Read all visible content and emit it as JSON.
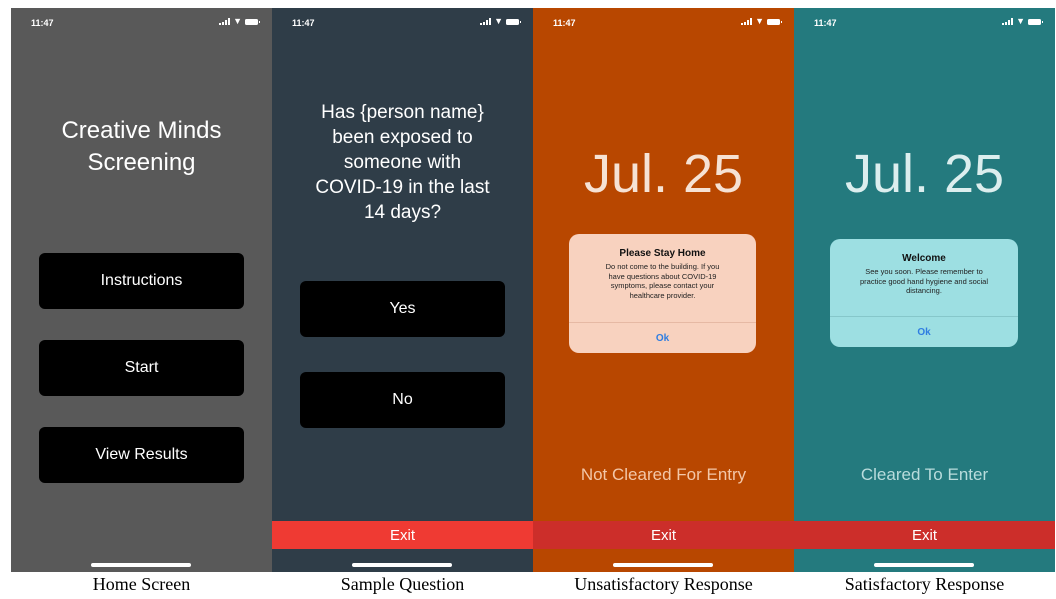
{
  "status_time": "11:47",
  "colors": {
    "home_bg": "#595959",
    "question_bg": "#2f3d48",
    "unsatisfactory_bg": "#b84700",
    "satisfactory_bg": "#247a7e",
    "exit_red": "#ef3a33",
    "exit_dark_red": "#cc2e2a",
    "stay_home_dialog": "#f8d2bf",
    "welcome_dialog": "#9ddfe2",
    "ok_blue": "#2f7de1"
  },
  "home": {
    "title": "Creative Minds\nScreening",
    "buttons": [
      "Instructions",
      "Start",
      "View Results"
    ]
  },
  "question": {
    "text": "Has {person name}\nbeen exposed to\nsomeone with\nCOVID-19 in the last\n14 days?",
    "yes": "Yes",
    "no": "No",
    "exit": "Exit"
  },
  "unsatisfactory": {
    "date": "Jul. 25",
    "dialog_title": "Please Stay Home",
    "dialog_body": "Do not come to the building. If you\nhave questions about COVID-19\nsymptoms, please contact your\nhealthcare provider.",
    "ok": "Ok",
    "status": "Not Cleared For Entry",
    "exit": "Exit"
  },
  "satisfactory": {
    "date": "Jul. 25",
    "dialog_title": "Welcome",
    "dialog_body": "See you soon. Please remember to\npractice good hand hygiene and social\ndistancing.",
    "ok": "Ok",
    "status": "Cleared To Enter",
    "exit": "Exit"
  },
  "captions": [
    "Home Screen",
    "Sample Question",
    "Unsatisfactory Response",
    "Satisfactory Response"
  ]
}
